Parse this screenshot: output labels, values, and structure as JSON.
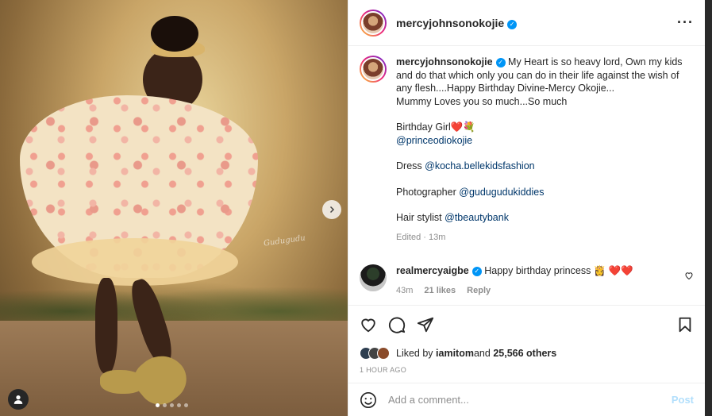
{
  "post": {
    "username": "mercyjohnsonokojie",
    "verified": true,
    "more_icon": "more-horizontal-icon"
  },
  "caption": {
    "username": "mercyjohnsonokojie",
    "text": "My Heart is so heavy lord, Own my kids and do that which only you can do in their life against the wish of any flesh....Happy Birthday Divine-Mercy Okojie...",
    "line2": "Mummy Loves you so much...So much",
    "birthday": "Birthday Girl❤️💐",
    "mention_bday": "@princeodiokojie",
    "dress_label": "Dress",
    "dress_mention": "@kocha.bellekidsfashion",
    "photographer_label": "Photographer",
    "photographer_mention": "@gudugudukiddies",
    "hair_label": "Hair stylist",
    "hair_mention": "@tbeautybank",
    "edited": "Edited · 13m"
  },
  "comment": {
    "username": "realmercyaigbe",
    "text": "Happy birthday princess 👸 ❤️❤️",
    "time": "43m",
    "likes": "21 likes",
    "reply": "Reply"
  },
  "likes": {
    "prefix": "Liked by ",
    "user": "iamitom",
    "middle": " and ",
    "count": "25,566 others"
  },
  "time_ago": "1 HOUR AGO",
  "add_comment": {
    "placeholder": "Add a comment...",
    "post_label": "Post"
  },
  "carousel": {
    "current": 1,
    "total": 5
  },
  "photo_signature": "Gudugudu",
  "colors": {
    "accent": "#0095f6",
    "link": "#00376b",
    "post_disabled": "#b2dffc",
    "heart": "#ed4956"
  }
}
